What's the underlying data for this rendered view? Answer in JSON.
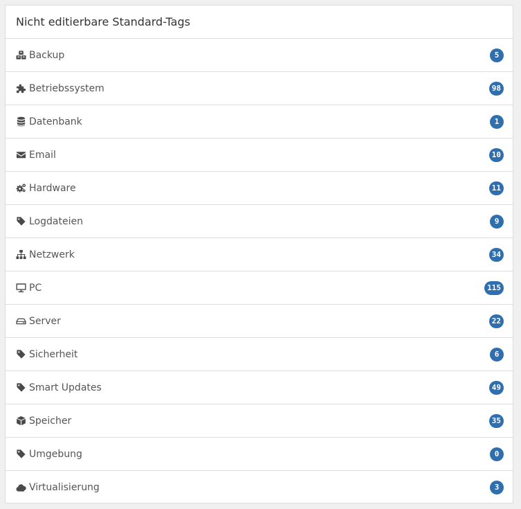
{
  "panel": {
    "title": "Nicht editierbare Standard-Tags"
  },
  "colors": {
    "badge": "#2f6fb0",
    "icon": "#4a4a4a"
  },
  "tags": [
    {
      "label": "Backup",
      "count": "5",
      "icon": "cubes-icon"
    },
    {
      "label": "Betriebssystem",
      "count": "98",
      "icon": "puzzle-icon"
    },
    {
      "label": "Datenbank",
      "count": "1",
      "icon": "database-icon"
    },
    {
      "label": "Email",
      "count": "10",
      "icon": "envelope-icon"
    },
    {
      "label": "Hardware",
      "count": "11",
      "icon": "gears-icon"
    },
    {
      "label": "Logdateien",
      "count": "9",
      "icon": "tag-icon"
    },
    {
      "label": "Netzwerk",
      "count": "34",
      "icon": "sitemap-icon"
    },
    {
      "label": "PC",
      "count": "115",
      "icon": "desktop-icon"
    },
    {
      "label": "Server",
      "count": "22",
      "icon": "hdd-icon"
    },
    {
      "label": "Sicherheit",
      "count": "6",
      "icon": "tag-icon"
    },
    {
      "label": "Smart Updates",
      "count": "49",
      "icon": "tag-icon"
    },
    {
      "label": "Speicher",
      "count": "35",
      "icon": "cube-icon"
    },
    {
      "label": "Umgebung",
      "count": "0",
      "icon": "tag-icon"
    },
    {
      "label": "Virtualisierung",
      "count": "3",
      "icon": "cloud-icon"
    }
  ]
}
